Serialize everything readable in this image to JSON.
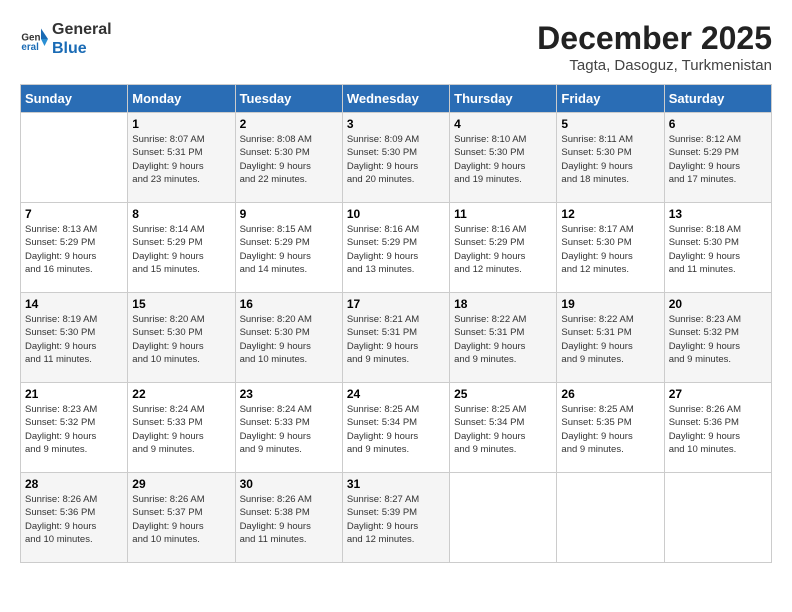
{
  "logo": {
    "line1": "General",
    "line2": "Blue"
  },
  "title": "December 2025",
  "subtitle": "Tagta, Dasoguz, Turkmenistan",
  "days_of_week": [
    "Sunday",
    "Monday",
    "Tuesday",
    "Wednesday",
    "Thursday",
    "Friday",
    "Saturday"
  ],
  "weeks": [
    [
      {
        "day": "",
        "info": ""
      },
      {
        "day": "1",
        "info": "Sunrise: 8:07 AM\nSunset: 5:31 PM\nDaylight: 9 hours\nand 23 minutes."
      },
      {
        "day": "2",
        "info": "Sunrise: 8:08 AM\nSunset: 5:30 PM\nDaylight: 9 hours\nand 22 minutes."
      },
      {
        "day": "3",
        "info": "Sunrise: 8:09 AM\nSunset: 5:30 PM\nDaylight: 9 hours\nand 20 minutes."
      },
      {
        "day": "4",
        "info": "Sunrise: 8:10 AM\nSunset: 5:30 PM\nDaylight: 9 hours\nand 19 minutes."
      },
      {
        "day": "5",
        "info": "Sunrise: 8:11 AM\nSunset: 5:30 PM\nDaylight: 9 hours\nand 18 minutes."
      },
      {
        "day": "6",
        "info": "Sunrise: 8:12 AM\nSunset: 5:29 PM\nDaylight: 9 hours\nand 17 minutes."
      }
    ],
    [
      {
        "day": "7",
        "info": "Sunrise: 8:13 AM\nSunset: 5:29 PM\nDaylight: 9 hours\nand 16 minutes."
      },
      {
        "day": "8",
        "info": "Sunrise: 8:14 AM\nSunset: 5:29 PM\nDaylight: 9 hours\nand 15 minutes."
      },
      {
        "day": "9",
        "info": "Sunrise: 8:15 AM\nSunset: 5:29 PM\nDaylight: 9 hours\nand 14 minutes."
      },
      {
        "day": "10",
        "info": "Sunrise: 8:16 AM\nSunset: 5:29 PM\nDaylight: 9 hours\nand 13 minutes."
      },
      {
        "day": "11",
        "info": "Sunrise: 8:16 AM\nSunset: 5:29 PM\nDaylight: 9 hours\nand 12 minutes."
      },
      {
        "day": "12",
        "info": "Sunrise: 8:17 AM\nSunset: 5:30 PM\nDaylight: 9 hours\nand 12 minutes."
      },
      {
        "day": "13",
        "info": "Sunrise: 8:18 AM\nSunset: 5:30 PM\nDaylight: 9 hours\nand 11 minutes."
      }
    ],
    [
      {
        "day": "14",
        "info": "Sunrise: 8:19 AM\nSunset: 5:30 PM\nDaylight: 9 hours\nand 11 minutes."
      },
      {
        "day": "15",
        "info": "Sunrise: 8:20 AM\nSunset: 5:30 PM\nDaylight: 9 hours\nand 10 minutes."
      },
      {
        "day": "16",
        "info": "Sunrise: 8:20 AM\nSunset: 5:30 PM\nDaylight: 9 hours\nand 10 minutes."
      },
      {
        "day": "17",
        "info": "Sunrise: 8:21 AM\nSunset: 5:31 PM\nDaylight: 9 hours\nand 9 minutes."
      },
      {
        "day": "18",
        "info": "Sunrise: 8:22 AM\nSunset: 5:31 PM\nDaylight: 9 hours\nand 9 minutes."
      },
      {
        "day": "19",
        "info": "Sunrise: 8:22 AM\nSunset: 5:31 PM\nDaylight: 9 hours\nand 9 minutes."
      },
      {
        "day": "20",
        "info": "Sunrise: 8:23 AM\nSunset: 5:32 PM\nDaylight: 9 hours\nand 9 minutes."
      }
    ],
    [
      {
        "day": "21",
        "info": "Sunrise: 8:23 AM\nSunset: 5:32 PM\nDaylight: 9 hours\nand 9 minutes."
      },
      {
        "day": "22",
        "info": "Sunrise: 8:24 AM\nSunset: 5:33 PM\nDaylight: 9 hours\nand 9 minutes."
      },
      {
        "day": "23",
        "info": "Sunrise: 8:24 AM\nSunset: 5:33 PM\nDaylight: 9 hours\nand 9 minutes."
      },
      {
        "day": "24",
        "info": "Sunrise: 8:25 AM\nSunset: 5:34 PM\nDaylight: 9 hours\nand 9 minutes."
      },
      {
        "day": "25",
        "info": "Sunrise: 8:25 AM\nSunset: 5:34 PM\nDaylight: 9 hours\nand 9 minutes."
      },
      {
        "day": "26",
        "info": "Sunrise: 8:25 AM\nSunset: 5:35 PM\nDaylight: 9 hours\nand 9 minutes."
      },
      {
        "day": "27",
        "info": "Sunrise: 8:26 AM\nSunset: 5:36 PM\nDaylight: 9 hours\nand 10 minutes."
      }
    ],
    [
      {
        "day": "28",
        "info": "Sunrise: 8:26 AM\nSunset: 5:36 PM\nDaylight: 9 hours\nand 10 minutes."
      },
      {
        "day": "29",
        "info": "Sunrise: 8:26 AM\nSunset: 5:37 PM\nDaylight: 9 hours\nand 10 minutes."
      },
      {
        "day": "30",
        "info": "Sunrise: 8:26 AM\nSunset: 5:38 PM\nDaylight: 9 hours\nand 11 minutes."
      },
      {
        "day": "31",
        "info": "Sunrise: 8:27 AM\nSunset: 5:39 PM\nDaylight: 9 hours\nand 12 minutes."
      },
      {
        "day": "",
        "info": ""
      },
      {
        "day": "",
        "info": ""
      },
      {
        "day": "",
        "info": ""
      }
    ]
  ]
}
